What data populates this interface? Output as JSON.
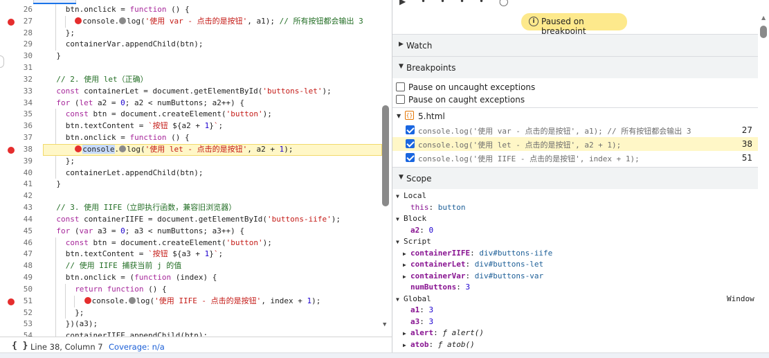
{
  "editor": {
    "lines": [
      {
        "num": "26",
        "bp": false,
        "tokens": [
          [
            "f",
            "btn.onclick = "
          ],
          [
            "k",
            "function"
          ],
          [
            "f",
            " () {"
          ]
        ],
        "indent": 2
      },
      {
        "num": "27",
        "bp": true,
        "tokens": [
          [
            "dot-red",
            ""
          ],
          [
            "f",
            "console."
          ],
          [
            "dot-gray",
            ""
          ],
          [
            "f",
            "log("
          ],
          [
            "s",
            "'使用 var - 点击的是按钮'"
          ],
          [
            "f",
            ", a1); "
          ],
          [
            "c",
            "// 所有按钮都会输出 3"
          ]
        ],
        "indent": 3
      },
      {
        "num": "28",
        "bp": false,
        "tokens": [
          [
            "f",
            "};"
          ]
        ],
        "indent": 2
      },
      {
        "num": "29",
        "bp": false,
        "tokens": [
          [
            "f",
            "containerVar.appendChild(btn);"
          ]
        ],
        "indent": 2
      },
      {
        "num": "30",
        "bp": false,
        "tokens": [
          [
            "f",
            "}"
          ]
        ],
        "indent": 1
      },
      {
        "num": "31",
        "bp": false,
        "tokens": [],
        "indent": 0
      },
      {
        "num": "32",
        "bp": false,
        "tokens": [
          [
            "c",
            "// 2. 使用 let（正确）"
          ]
        ],
        "indent": 1
      },
      {
        "num": "33",
        "bp": false,
        "tokens": [
          [
            "k",
            "const"
          ],
          [
            "f",
            " containerLet = document.getElementById("
          ],
          [
            "s",
            "'buttons-let'"
          ],
          [
            "f",
            ");"
          ]
        ],
        "indent": 1
      },
      {
        "num": "34",
        "bp": false,
        "tokens": [
          [
            "k",
            "for"
          ],
          [
            "f",
            " ("
          ],
          [
            "k",
            "let"
          ],
          [
            "f",
            " a2 = "
          ],
          [
            "n",
            "0"
          ],
          [
            "f",
            "; a2 < numButtons; a2++) {"
          ]
        ],
        "indent": 1
      },
      {
        "num": "35",
        "bp": false,
        "tokens": [
          [
            "k",
            "const"
          ],
          [
            "f",
            " btn = document.createElement("
          ],
          [
            "s",
            "'button'"
          ],
          [
            "f",
            ");"
          ]
        ],
        "indent": 2
      },
      {
        "num": "36",
        "bp": false,
        "tokens": [
          [
            "f",
            "btn.textContent = "
          ],
          [
            "s",
            "`按钮 "
          ],
          [
            "f",
            "${a2 + "
          ],
          [
            "n",
            "1"
          ],
          [
            "f",
            "}"
          ],
          [
            "s",
            "`"
          ],
          [
            "f",
            ";"
          ]
        ],
        "indent": 2
      },
      {
        "num": "37",
        "bp": false,
        "tokens": [
          [
            "f",
            "btn.onclick = "
          ],
          [
            "k",
            "function"
          ],
          [
            "f",
            " () {"
          ]
        ],
        "indent": 2
      },
      {
        "num": "38",
        "bp": true,
        "hl": true,
        "tokens": [
          [
            "dot-red",
            ""
          ],
          [
            "sel",
            "console"
          ],
          [
            "f",
            "."
          ],
          [
            "dot-gray",
            ""
          ],
          [
            "f",
            "log("
          ],
          [
            "s",
            "'使用 let - 点击的是按钮'"
          ],
          [
            "f",
            ", a2 + "
          ],
          [
            "n",
            "1"
          ],
          [
            "f",
            ");"
          ]
        ],
        "indent": 3
      },
      {
        "num": "39",
        "bp": false,
        "tokens": [
          [
            "f",
            "};"
          ]
        ],
        "indent": 2
      },
      {
        "num": "40",
        "bp": false,
        "tokens": [
          [
            "f",
            "containerLet.appendChild(btn);"
          ]
        ],
        "indent": 2
      },
      {
        "num": "41",
        "bp": false,
        "tokens": [
          [
            "f",
            "}"
          ]
        ],
        "indent": 1
      },
      {
        "num": "42",
        "bp": false,
        "tokens": [],
        "indent": 0
      },
      {
        "num": "43",
        "bp": false,
        "tokens": [
          [
            "c",
            "// 3. 使用 IIFE（立即执行函数，兼容旧浏览器）"
          ]
        ],
        "indent": 1
      },
      {
        "num": "44",
        "bp": false,
        "tokens": [
          [
            "k",
            "const"
          ],
          [
            "f",
            " containerIIFE = document.getElementById("
          ],
          [
            "s",
            "'buttons-iife'"
          ],
          [
            "f",
            ");"
          ]
        ],
        "indent": 1
      },
      {
        "num": "45",
        "bp": false,
        "tokens": [
          [
            "k",
            "for"
          ],
          [
            "f",
            " ("
          ],
          [
            "k",
            "var"
          ],
          [
            "f",
            " a3 = "
          ],
          [
            "n",
            "0"
          ],
          [
            "f",
            "; a3 < numButtons; a3++) {"
          ]
        ],
        "indent": 1
      },
      {
        "num": "46",
        "bp": false,
        "tokens": [
          [
            "k",
            "const"
          ],
          [
            "f",
            " btn = document.createElement("
          ],
          [
            "s",
            "'button'"
          ],
          [
            "f",
            ");"
          ]
        ],
        "indent": 2
      },
      {
        "num": "47",
        "bp": false,
        "tokens": [
          [
            "f",
            "btn.textContent = "
          ],
          [
            "s",
            "`按钮 "
          ],
          [
            "f",
            "${a3 + "
          ],
          [
            "n",
            "1"
          ],
          [
            "f",
            "}"
          ],
          [
            "s",
            "`"
          ],
          [
            "f",
            ";"
          ]
        ],
        "indent": 2
      },
      {
        "num": "48",
        "bp": false,
        "tokens": [
          [
            "c",
            "// 使用 IIFE 捕获当前 j 的值"
          ]
        ],
        "indent": 2
      },
      {
        "num": "49",
        "bp": false,
        "tokens": [
          [
            "f",
            "btn.onclick = ("
          ],
          [
            "k",
            "function"
          ],
          [
            "f",
            " (index) {"
          ]
        ],
        "indent": 2
      },
      {
        "num": "50",
        "bp": false,
        "tokens": [
          [
            "k",
            "return"
          ],
          [
            "f",
            " "
          ],
          [
            "k",
            "function"
          ],
          [
            "f",
            " () {"
          ]
        ],
        "indent": 3
      },
      {
        "num": "51",
        "bp": true,
        "tokens": [
          [
            "dot-red",
            ""
          ],
          [
            "f",
            "console."
          ],
          [
            "dot-gray",
            ""
          ],
          [
            "f",
            "log("
          ],
          [
            "s",
            "'使用 IIFE - 点击的是按钮'"
          ],
          [
            "f",
            ", index + "
          ],
          [
            "n",
            "1"
          ],
          [
            "f",
            ");"
          ]
        ],
        "indent": 4
      },
      {
        "num": "52",
        "bp": false,
        "tokens": [
          [
            "f",
            "};"
          ]
        ],
        "indent": 3
      },
      {
        "num": "53",
        "bp": false,
        "tokens": [
          [
            "f",
            "})(a3);"
          ]
        ],
        "indent": 2
      },
      {
        "num": "54",
        "bp": false,
        "tokens": [
          [
            "f",
            "containerIIFE.appendChild(btn);"
          ]
        ],
        "indent": 2
      }
    ]
  },
  "statusbar": {
    "braces": "{ }",
    "position": "Line 38, Column 7",
    "coverage": "Coverage: n/a"
  },
  "debugger": {
    "paused_label": "Paused on breakpoint",
    "paused_icon": "i",
    "sections": {
      "watch": "Watch",
      "breakpoints": "Breakpoints",
      "scope": "Scope"
    },
    "exceptions": {
      "uncaught": "Pause on uncaught exceptions",
      "caught": "Pause on caught exceptions"
    },
    "file": {
      "name": "5.html",
      "icon": "{}"
    },
    "breakpoints": [
      {
        "text": "console.log('使用 var - 点击的是按钮', a1); // 所有按钮都会输出 3",
        "line": "27",
        "checked": true,
        "hl": false
      },
      {
        "text": "console.log('使用 let - 点击的是按钮', a2 + 1);",
        "line": "38",
        "checked": true,
        "hl": true
      },
      {
        "text": "console.log('使用 IIFE - 点击的是按钮', index + 1);",
        "line": "51",
        "checked": true,
        "hl": false
      }
    ],
    "scope": {
      "local": {
        "label": "Local",
        "items": [
          {
            "key": "this",
            "value": "button"
          }
        ]
      },
      "block": {
        "label": "Block",
        "items": [
          {
            "key": "a2",
            "value": "0"
          }
        ]
      },
      "script": {
        "label": "Script",
        "items": [
          {
            "key": "containerIIFE",
            "value": "div#buttons-iife"
          },
          {
            "key": "containerLet",
            "value": "div#buttons-let"
          },
          {
            "key": "containerVar",
            "value": "div#buttons-var"
          },
          {
            "key": "numButtons",
            "value": "3"
          }
        ]
      },
      "global": {
        "label": "Global",
        "value": "Window",
        "items": [
          {
            "key": "a1",
            "value": "3"
          },
          {
            "key": "a3",
            "value": "3"
          },
          {
            "key": "alert",
            "value": "ƒ alert()"
          },
          {
            "key": "atob",
            "value": "ƒ atob()"
          }
        ]
      }
    }
  },
  "colors": {
    "breakpoint": "#e52d2d",
    "highlight": "#fff7c7",
    "paused_pill": "#fde98c",
    "checkbox": "#1a66e0"
  }
}
